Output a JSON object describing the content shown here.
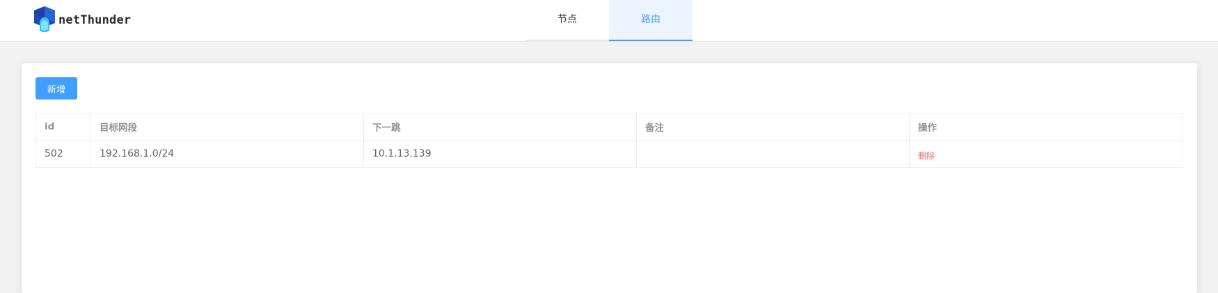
{
  "app": {
    "logo_text": "netThunder",
    "logo_colors": {
      "dark": "#1f3fa8",
      "mid": "#2a63d6",
      "light": "#37c3f0"
    }
  },
  "nav": {
    "tabs": [
      {
        "label": "节点",
        "active": false
      },
      {
        "label": "路由",
        "active": true
      }
    ]
  },
  "toolbar": {
    "add_label": "新增"
  },
  "table": {
    "headers": {
      "id": "id",
      "target": "目标网段",
      "next_hop": "下一跳",
      "remark": "备注",
      "actions": "操作"
    },
    "rows": [
      {
        "id": "502",
        "target": "192.168.1.0/24",
        "next_hop": "10.1.13.139",
        "remark": "",
        "delete_label": "删除"
      }
    ]
  },
  "colors": {
    "accent": "#409eff",
    "active_tab_bg": "#ecf5ff",
    "danger": "#f56c6c",
    "page_bg": "#f2f2f2"
  }
}
